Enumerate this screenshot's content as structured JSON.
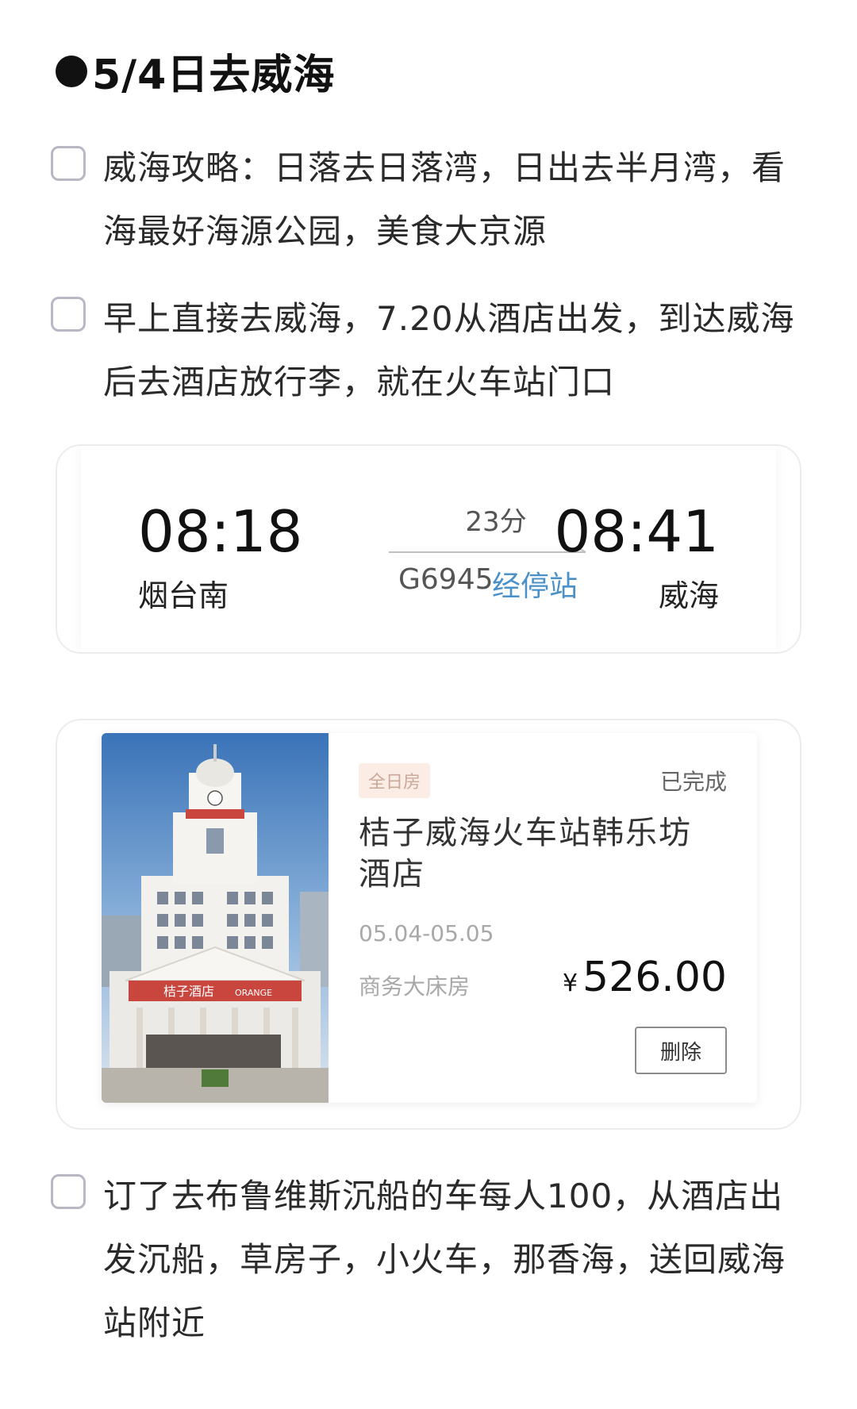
{
  "heading": "5/4日去威海",
  "todos": [
    {
      "text": "威海攻略：日落去日落湾，日出去半月湾，看海最好海源公园，美食大京源",
      "checked": false
    },
    {
      "text": "早上直接去威海，7.20从酒店出发，到达威海后去酒店放行李，就在火车站门口",
      "checked": false
    },
    {
      "text": "订了去布鲁维斯沉船的车每人100，从酒店出发沉船，草房子，小火车，那香海，送回威海站附近",
      "checked": false
    }
  ],
  "train": {
    "depart_time": "08:18",
    "depart_station": "烟台南",
    "duration": "23分",
    "train_no": "G6945",
    "stops_link": "经停站",
    "arrive_time": "08:41",
    "arrive_station": "威海"
  },
  "hotel": {
    "tag": "全日房",
    "status": "已完成",
    "name": "桔子威海火车站韩乐坊酒店",
    "dates": "05.04-05.05",
    "room_type": "商务大床房",
    "currency": "¥",
    "price": "526.00",
    "delete_label": "删除",
    "photo_sign": "桔子酒店",
    "photo_sign_en": "ORANGE"
  },
  "colors": {
    "link": "#4a90c9",
    "tag_bg": "#fbece6",
    "tag_text": "#c9a898"
  }
}
